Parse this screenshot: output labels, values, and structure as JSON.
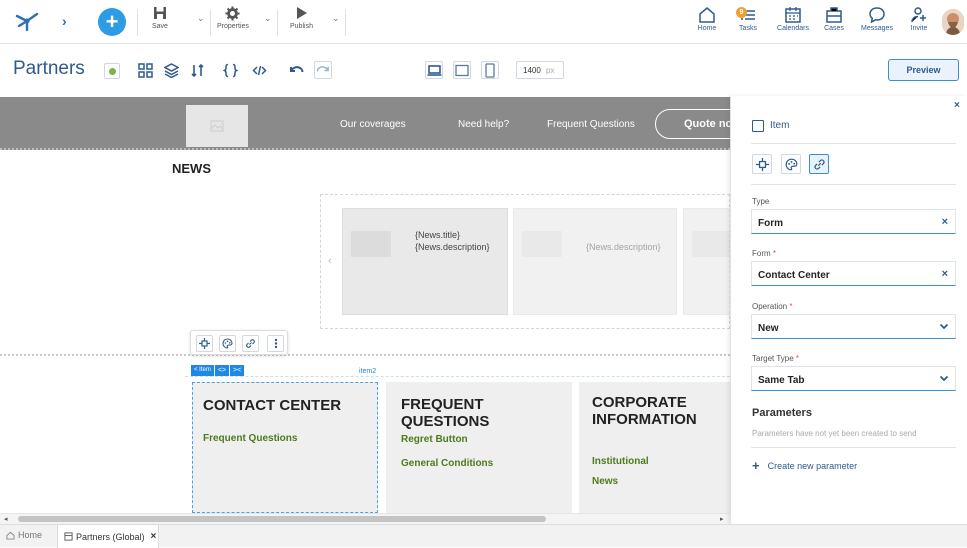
{
  "topbar": {
    "save_label": "Save",
    "properties_label": "Properties",
    "publish_label": "Publish",
    "nav": [
      {
        "label": "Home",
        "icon": "home-icon"
      },
      {
        "label": "Tasks",
        "icon": "tasks-icon",
        "badge": "9"
      },
      {
        "label": "Calendars",
        "icon": "calendar-icon"
      },
      {
        "label": "Cases",
        "icon": "briefcase-icon"
      },
      {
        "label": "Messages",
        "icon": "chat-icon"
      },
      {
        "label": "Invite",
        "icon": "invite-icon"
      }
    ]
  },
  "toolbar": {
    "title": "Partners",
    "width_value": "1400",
    "width_unit": "px",
    "preview_label": "Preview"
  },
  "site": {
    "nav_links": [
      "Our coverages",
      "Need help?",
      "Frequent Questions"
    ],
    "quote_button": "Quote no",
    "news_heading": "NEWS",
    "news_cards": [
      {
        "title": "{News.title}",
        "description": "{News.description}"
      },
      {
        "description": "{News.description}"
      }
    ],
    "item_tag": "item2",
    "item_chip": "< Item",
    "columns": [
      {
        "heading": "CONTACT CENTER",
        "links": [
          "Frequent Questions"
        ]
      },
      {
        "heading": "FREQUENT QUESTIONS",
        "links": [
          "Regret Button",
          "General Conditions"
        ]
      },
      {
        "heading": "CORPORATE INFORMATION",
        "links": [
          "Institutional",
          "News"
        ]
      }
    ]
  },
  "panel": {
    "title": "Item",
    "fields": {
      "type_label": "Type",
      "type_value": "Form",
      "form_label": "Form",
      "form_value": "Contact Center",
      "operation_label": "Operation",
      "operation_value": "New",
      "target_label": "Target Type",
      "target_value": "Same Tab"
    },
    "parameters_heading": "Parameters",
    "parameters_empty": "Parameters have not yet been created to send",
    "create_parameter": "Create new parameter"
  },
  "bottom": {
    "home_tab": "Home",
    "active_tab": "Partners (Global)"
  },
  "colors": {
    "accent": "#2f5a8f",
    "link_blue": "#3a8fd3",
    "plus_button": "#2e9be5",
    "site_nav_bg": "#8a8a8a",
    "link_green": "#4d7a1c"
  }
}
